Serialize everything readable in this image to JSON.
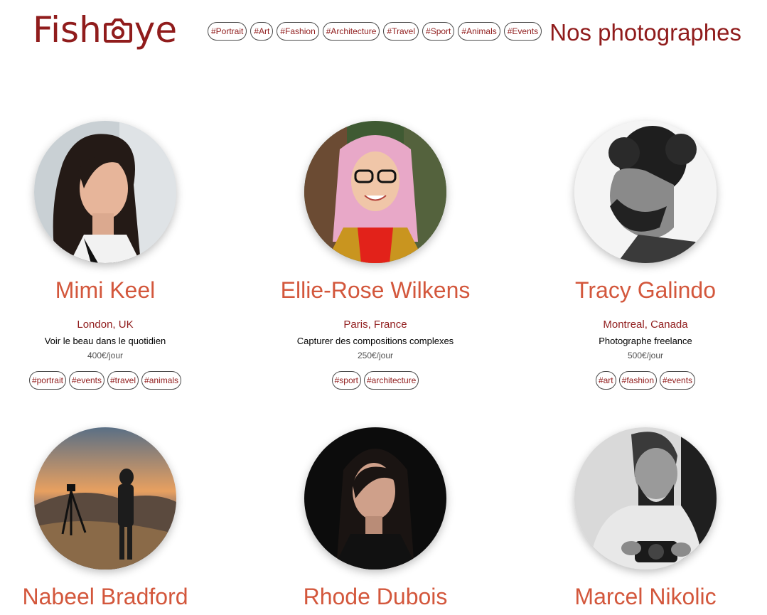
{
  "header": {
    "logo_left": "Fish",
    "logo_right": "ye",
    "nav_tags": [
      "#Portrait",
      "#Art",
      "#Fashion",
      "#Architecture",
      "#Travel",
      "#Sport",
      "#Animals",
      "#Events"
    ],
    "page_title": "Nos photographes"
  },
  "photographers": [
    {
      "name": "Mimi Keel",
      "location": "London, UK",
      "tagline": "Voir le beau dans le quotidien",
      "price": "400€/jour",
      "tags": [
        "#portrait",
        "#events",
        "#travel",
        "#animals"
      ],
      "portrait_alt": "Mimi Keel"
    },
    {
      "name": "Ellie-Rose Wilkens",
      "location": "Paris, France",
      "tagline": "Capturer des compositions complexes",
      "price": "250€/jour",
      "tags": [
        "#sport",
        "#architecture"
      ],
      "portrait_alt": "Ellie-Rose Wilkens"
    },
    {
      "name": "Tracy Galindo",
      "location": "Montreal, Canada",
      "tagline": "Photographe freelance",
      "price": "500€/jour",
      "tags": [
        "#art",
        "#fashion",
        "#events"
      ],
      "portrait_alt": "Tracy Galindo"
    },
    {
      "name": "Nabeel Bradford",
      "location": "",
      "tagline": "",
      "price": "",
      "tags": [],
      "portrait_alt": "Nabeel Bradford"
    },
    {
      "name": "Rhode Dubois",
      "location": "",
      "tagline": "",
      "price": "",
      "tags": [],
      "portrait_alt": "Rhode Dubois"
    },
    {
      "name": "Marcel Nikolic",
      "location": "",
      "tagline": "",
      "price": "",
      "tags": [],
      "portrait_alt": "Marcel Nikolic"
    }
  ],
  "colors": {
    "primary": "#901C1C",
    "accent": "#D3573C",
    "price": "#525252"
  },
  "icons": {
    "logo": "camera-icon"
  }
}
